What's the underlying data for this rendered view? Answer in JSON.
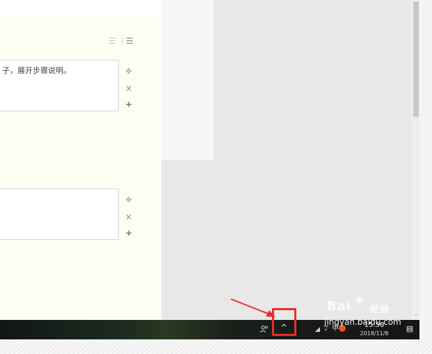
{
  "editor": {
    "step1_text": "子，展开步骤说明。",
    "list_icons": [
      "ordered-list-icon",
      "unordered-list-icon"
    ]
  },
  "step_controls": {
    "move_symbol": "✥",
    "delete_symbol": "×",
    "add_symbol": "+"
  },
  "taskbar": {
    "people_icon": "people-icon",
    "chevron": "^",
    "time": "15:50",
    "date": "2018/11/8",
    "notify_count": "1"
  },
  "watermark": {
    "logo": "Bai",
    "logo_cn": "经验",
    "url": "jingyan.baidu.com"
  },
  "colors": {
    "highlight": "#e8302a",
    "editor_bg": "#fdfdf1",
    "panel_bg": "#e8e8e8"
  }
}
